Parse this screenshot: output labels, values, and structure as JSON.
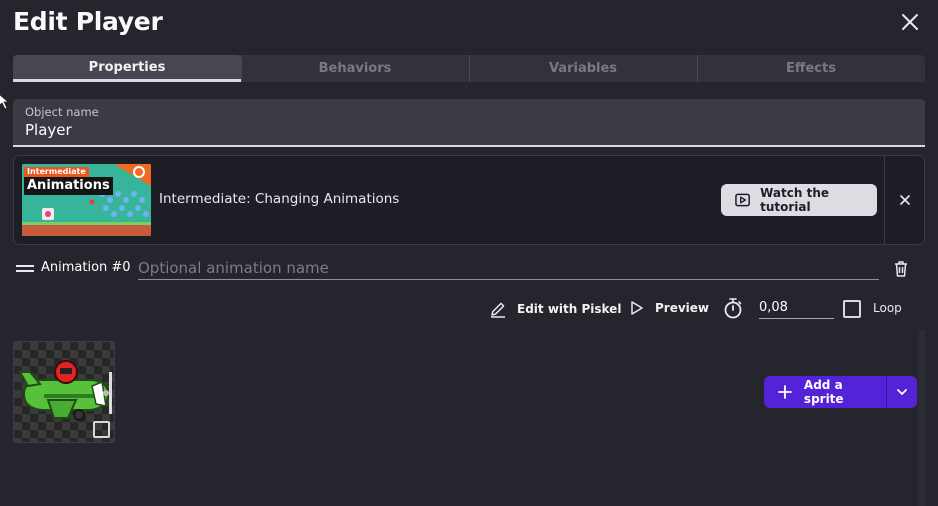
{
  "dialog": {
    "title": "Edit Player",
    "close_icon": "close-icon"
  },
  "tabs": [
    {
      "label": "Properties",
      "active": true
    },
    {
      "label": "Behaviors",
      "active": false
    },
    {
      "label": "Variables",
      "active": false
    },
    {
      "label": "Effects",
      "active": false
    }
  ],
  "object_name": {
    "label": "Object name",
    "value": "Player"
  },
  "tutorial": {
    "thumbnail_tag": "Intermediate",
    "thumbnail_title": "Animations",
    "title": "Intermediate: Changing Animations",
    "watch_label": "Watch the tutorial"
  },
  "animation": {
    "label": "Animation #0",
    "name_placeholder": "Optional animation name",
    "name_value": ""
  },
  "toolbar": {
    "edit_label": "Edit with Piskel",
    "preview_label": "Preview",
    "speed_value": "0,08",
    "loop_label": "Loop",
    "loop_checked": false
  },
  "sprites": [
    {
      "name": "plane-sprite",
      "selected": false
    }
  ],
  "add_sprite": {
    "label": "Add a sprite"
  },
  "colors": {
    "background": "#25252e",
    "accent_purple": "#5423d7",
    "tab_active": "#474752",
    "field_bg": "#3b3b46"
  }
}
